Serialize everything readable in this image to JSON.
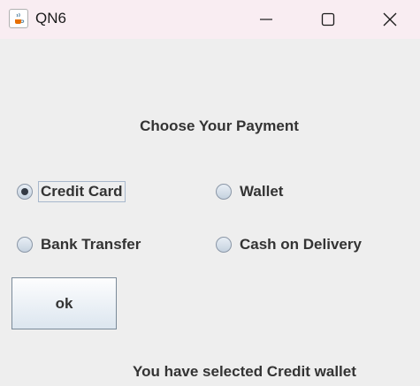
{
  "window": {
    "title": "QN6",
    "icon": "java-cup-icon",
    "controls": [
      "minimize",
      "maximize",
      "close"
    ]
  },
  "heading": "Choose Your Payment",
  "payment_options": [
    {
      "label": "Credit Card",
      "checked": true
    },
    {
      "label": "Wallet",
      "checked": false
    },
    {
      "label": "Bank Transfer",
      "checked": false
    },
    {
      "label": "Cash on Delivery",
      "checked": false
    }
  ],
  "ok_label": "ok",
  "status": "You have selected Credit wallet"
}
